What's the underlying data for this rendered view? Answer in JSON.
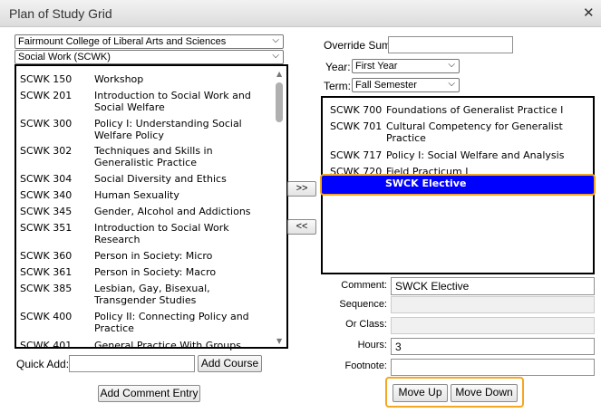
{
  "window": {
    "title": "Plan of Study Grid",
    "close_icon": "close-icon"
  },
  "left": {
    "college": "Fairmount College of Liberal Arts and Sciences",
    "department": "Social Work (SCWK)",
    "courses": [
      {
        "code": "SCWK 150",
        "name": "Workshop"
      },
      {
        "code": "SCWK 201",
        "name": "Introduction to Social Work and Social Welfare"
      },
      {
        "code": "SCWK 300",
        "name": "Policy I: Understanding Social Welfare Policy"
      },
      {
        "code": "SCWK 302",
        "name": "Techniques and Skills in Generalistic Practice"
      },
      {
        "code": "SCWK 304",
        "name": "Social Diversity and Ethics"
      },
      {
        "code": "SCWK 340",
        "name": "Human Sexuality"
      },
      {
        "code": "SCWK 345",
        "name": "Gender, Alcohol and Addictions"
      },
      {
        "code": "SCWK 351",
        "name": "Introduction to Social Work Research"
      },
      {
        "code": "SCWK 360",
        "name": "Person in Society: Micro"
      },
      {
        "code": "SCWK 361",
        "name": "Person in Society: Macro"
      },
      {
        "code": "SCWK 385",
        "name": "Lesbian, Gay, Bisexual, Transgender Studies"
      },
      {
        "code": "SCWK 400",
        "name": "Policy II: Connecting Policy and Practice"
      },
      {
        "code": "SCWK 401",
        "name": "General Practice With Groups"
      }
    ],
    "quick_add_label": "Quick Add:",
    "quick_add_value": "",
    "add_course": "Add Course",
    "add_comment": "Add Comment Entry"
  },
  "transfer": {
    "add": ">>",
    "remove": "<<"
  },
  "right": {
    "override_label": "Override Sum",
    "override_value": "",
    "year_label": "Year:",
    "year": "First Year",
    "term_label": "Term:",
    "term": "Fall Semester",
    "plan": [
      {
        "code": "SCWK 700",
        "name": "Foundations of Generalist Practice I"
      },
      {
        "code": "SCWK 701",
        "name": "Cultural Competency for Generalist Practice"
      },
      {
        "code": "SCWK 717",
        "name": "Policy I: Social Welfare and Analysis"
      },
      {
        "code": "SCWK 720",
        "name": "Field Practicum I"
      },
      {
        "code": "",
        "name": "SWCK Elective",
        "selected": true
      }
    ],
    "comment_label": "Comment:",
    "comment": "SWCK Elective",
    "sequence_label": "Sequence:",
    "sequence": "",
    "orclass_label": "Or Class:",
    "orclass": "",
    "hours_label": "Hours:",
    "hours": "3",
    "footnote_label": "Footnote:",
    "footnote": "",
    "move_up": "Move Up",
    "move_down": "Move Down"
  },
  "colors": {
    "selected": "#0000ff",
    "highlight": "#f5a623"
  }
}
